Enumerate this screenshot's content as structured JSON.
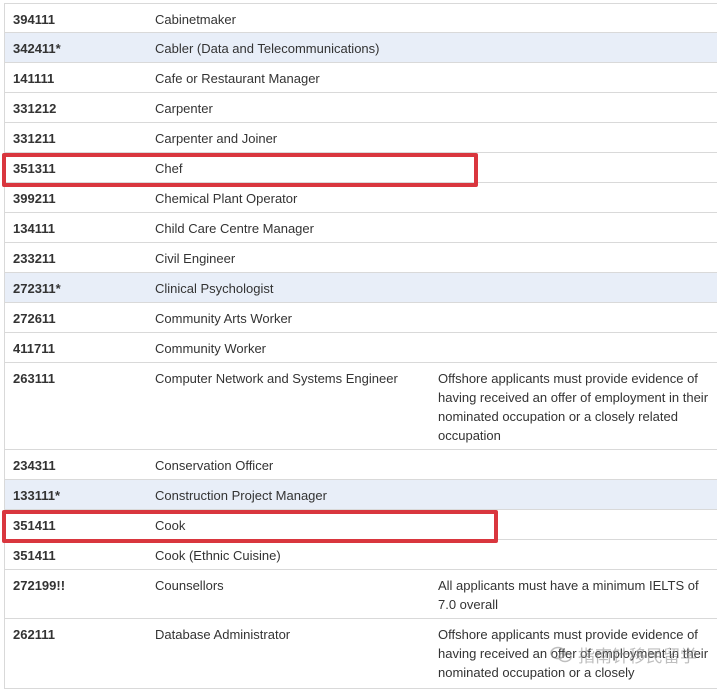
{
  "rows": [
    {
      "code": "394111",
      "occupation": "Cabinetmaker",
      "note": "",
      "highlight": false
    },
    {
      "code": "342411*",
      "occupation": "Cabler (Data and Telecommunications)",
      "note": "",
      "highlight": true
    },
    {
      "code": "141111",
      "occupation": "Cafe or Restaurant Manager",
      "note": "",
      "highlight": false
    },
    {
      "code": "331212",
      "occupation": "Carpenter",
      "note": "",
      "highlight": false
    },
    {
      "code": "331211",
      "occupation": "Carpenter and Joiner",
      "note": "",
      "highlight": false
    },
    {
      "code": "351311",
      "occupation": "Chef",
      "note": "",
      "highlight": false
    },
    {
      "code": "399211",
      "occupation": "Chemical Plant Operator",
      "note": "",
      "highlight": false
    },
    {
      "code": "134111",
      "occupation": "Child Care Centre Manager",
      "note": "",
      "highlight": false
    },
    {
      "code": "233211",
      "occupation": "Civil Engineer",
      "note": "",
      "highlight": false
    },
    {
      "code": "272311*",
      "occupation": "Clinical Psychologist",
      "note": "",
      "highlight": true
    },
    {
      "code": "272611",
      "occupation": "Community Arts Worker",
      "note": "",
      "highlight": false
    },
    {
      "code": "411711",
      "occupation": "Community Worker",
      "note": "",
      "highlight": false
    },
    {
      "code": "263111",
      "occupation": "Computer Network and Systems Engineer",
      "note": "Offshore applicants must provide evidence of having received an offer of employment in their nominated occupation or a closely related occupation",
      "highlight": false
    },
    {
      "code": "234311",
      "occupation": "Conservation Officer",
      "note": "",
      "highlight": false
    },
    {
      "code": "133111*",
      "occupation": "Construction Project Manager",
      "note": "",
      "highlight": true
    },
    {
      "code": "351411",
      "occupation": "Cook",
      "note": "",
      "highlight": false
    },
    {
      "code": "351411",
      "occupation": "Cook (Ethnic Cuisine)",
      "note": "",
      "highlight": false
    },
    {
      "code": "272199!!",
      "occupation": "Counsellors",
      "note": "All applicants must have a minimum IELTS of 7.0 overall",
      "highlight": false
    },
    {
      "code": "262111",
      "occupation": "Database Administrator",
      "note": "Offshore applicants must  provide evidence of having received an offer of employment in their nominated occupation or a closely",
      "highlight": false
    }
  ],
  "watermark": {
    "text": "指南针移民留学"
  },
  "colors": {
    "highlight_row": "#e8eef8",
    "red_box": "#d9363e",
    "border": "#d9d9d9"
  }
}
